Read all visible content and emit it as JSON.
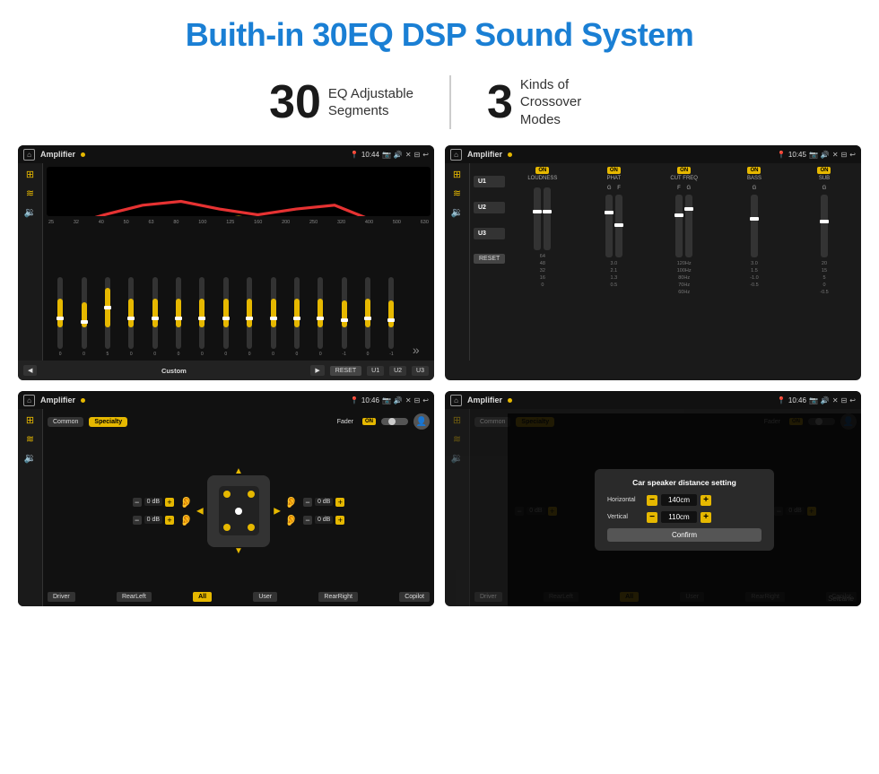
{
  "header": {
    "title": "Buith-in 30EQ DSP Sound System"
  },
  "stats": [
    {
      "number": "30",
      "desc": "EQ Adjustable\nSegments"
    },
    {
      "number": "3",
      "desc": "Kinds of\nCrossover Modes"
    }
  ],
  "screens": [
    {
      "id": "screen-eq",
      "topbar": {
        "title": "Amplifier",
        "time": "10:44"
      },
      "type": "eq",
      "freq_labels": [
        "25",
        "32",
        "40",
        "50",
        "63",
        "80",
        "100",
        "125",
        "160",
        "200",
        "250",
        "320",
        "400",
        "500",
        "630"
      ],
      "bottom": {
        "prev": "◀",
        "label": "Custom",
        "next": "▶",
        "reset": "RESET",
        "u1": "U1",
        "u2": "U2",
        "u3": "U3"
      }
    },
    {
      "id": "screen-crossover",
      "topbar": {
        "title": "Amplifier",
        "time": "10:45"
      },
      "type": "crossover",
      "u_buttons": [
        "U1",
        "U2",
        "U3"
      ],
      "columns": [
        {
          "label": "LOUDNESS",
          "on": true
        },
        {
          "label": "PHAT",
          "on": true
        },
        {
          "label": "CUT FREQ",
          "on": true
        },
        {
          "label": "BASS",
          "on": true
        },
        {
          "label": "SUB",
          "on": true
        }
      ],
      "bottom": {
        "reset": "RESET"
      }
    },
    {
      "id": "screen-speaker",
      "topbar": {
        "title": "Amplifier",
        "time": "10:46"
      },
      "type": "speaker",
      "tabs": [
        "Common",
        "Specialty"
      ],
      "fader_label": "Fader",
      "fader_on": "ON",
      "channels": [
        {
          "label": "0 dB"
        },
        {
          "label": "0 dB"
        },
        {
          "label": "0 dB"
        },
        {
          "label": "0 dB"
        }
      ],
      "bottom_btns": [
        "Driver",
        "RearLeft",
        "All",
        "User",
        "RearRight",
        "Copilot"
      ]
    },
    {
      "id": "screen-distance",
      "topbar": {
        "title": "Amplifier",
        "time": "10:46"
      },
      "type": "distance",
      "tabs": [
        "Common",
        "Specialty"
      ],
      "dialog": {
        "title": "Car speaker distance setting",
        "horizontal_label": "Horizontal",
        "horizontal_val": "140cm",
        "vertical_label": "Vertical",
        "vertical_val": "110cm",
        "confirm": "Confirm"
      },
      "channels": [
        {
          "label": "0 dB"
        },
        {
          "label": "0 dB"
        }
      ],
      "bottom_btns": [
        "Driver",
        "RearLeft",
        "All",
        "User",
        "RearRight",
        "Copilot"
      ]
    }
  ],
  "watermark": "Seicane"
}
